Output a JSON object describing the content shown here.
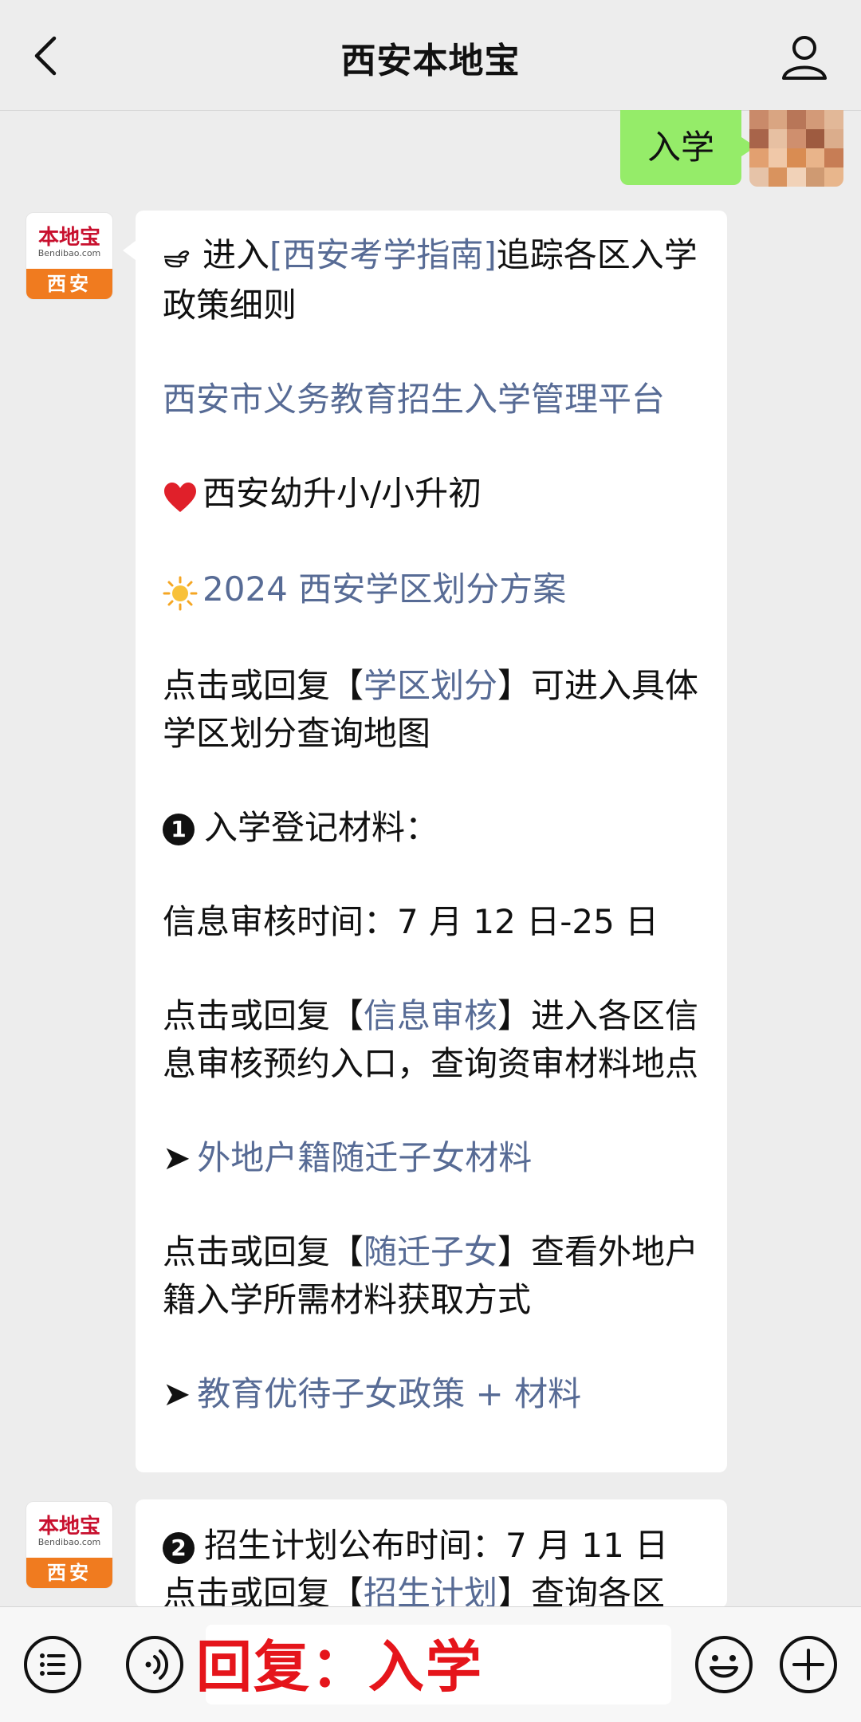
{
  "header": {
    "title": "西安本地宝"
  },
  "user_message": {
    "text": "入学"
  },
  "bot_avatar": {
    "logo": "本地宝",
    "domain": "Bendibao.com",
    "city": "西安"
  },
  "message1": {
    "line1_prefix": "进入",
    "line1_link": "[西安考学指南]",
    "line1_suffix": "追踪各区入学政策细则",
    "link_platform": "西安市义务教育招生入学管理平台",
    "heart_text": "西安幼升小/小升初",
    "sun_link": "2024 西安学区划分方案",
    "xq_prefix": "点击或回复【",
    "xq_link": "学区划分",
    "xq_suffix": "】可进入具体学区划分查询地图",
    "step1_num": "1",
    "step1_text": "入学登记材料：",
    "review_time": "信息审核时间：7 月 12 日-25 日",
    "review_prefix": "点击或回复【",
    "review_link": "信息审核",
    "review_suffix": "】进入各区信息审核预约入口，查询资审材料地点",
    "arrow1": "➤",
    "migrant_link": "外地户籍随迁子女材料",
    "migrant_prefix": "点击或回复【",
    "migrant_kw": "随迁子女",
    "migrant_suffix": "】查看外地户籍入学所需材料获取方式",
    "arrow2": "➤",
    "priority_link": "教育优待子女政策 + 材料"
  },
  "message2": {
    "step2_num": "2",
    "step2_text": "招生计划公布时间：7 月 11 日",
    "plan_prefix": "点击或回复【",
    "plan_link": "招生计划",
    "plan_suffix": "】查询各区"
  },
  "overlay": {
    "text": "回复：入学"
  },
  "colors": {
    "link": "#576b95",
    "bubble_user": "#95ec69",
    "overlay": "#e5151b"
  }
}
